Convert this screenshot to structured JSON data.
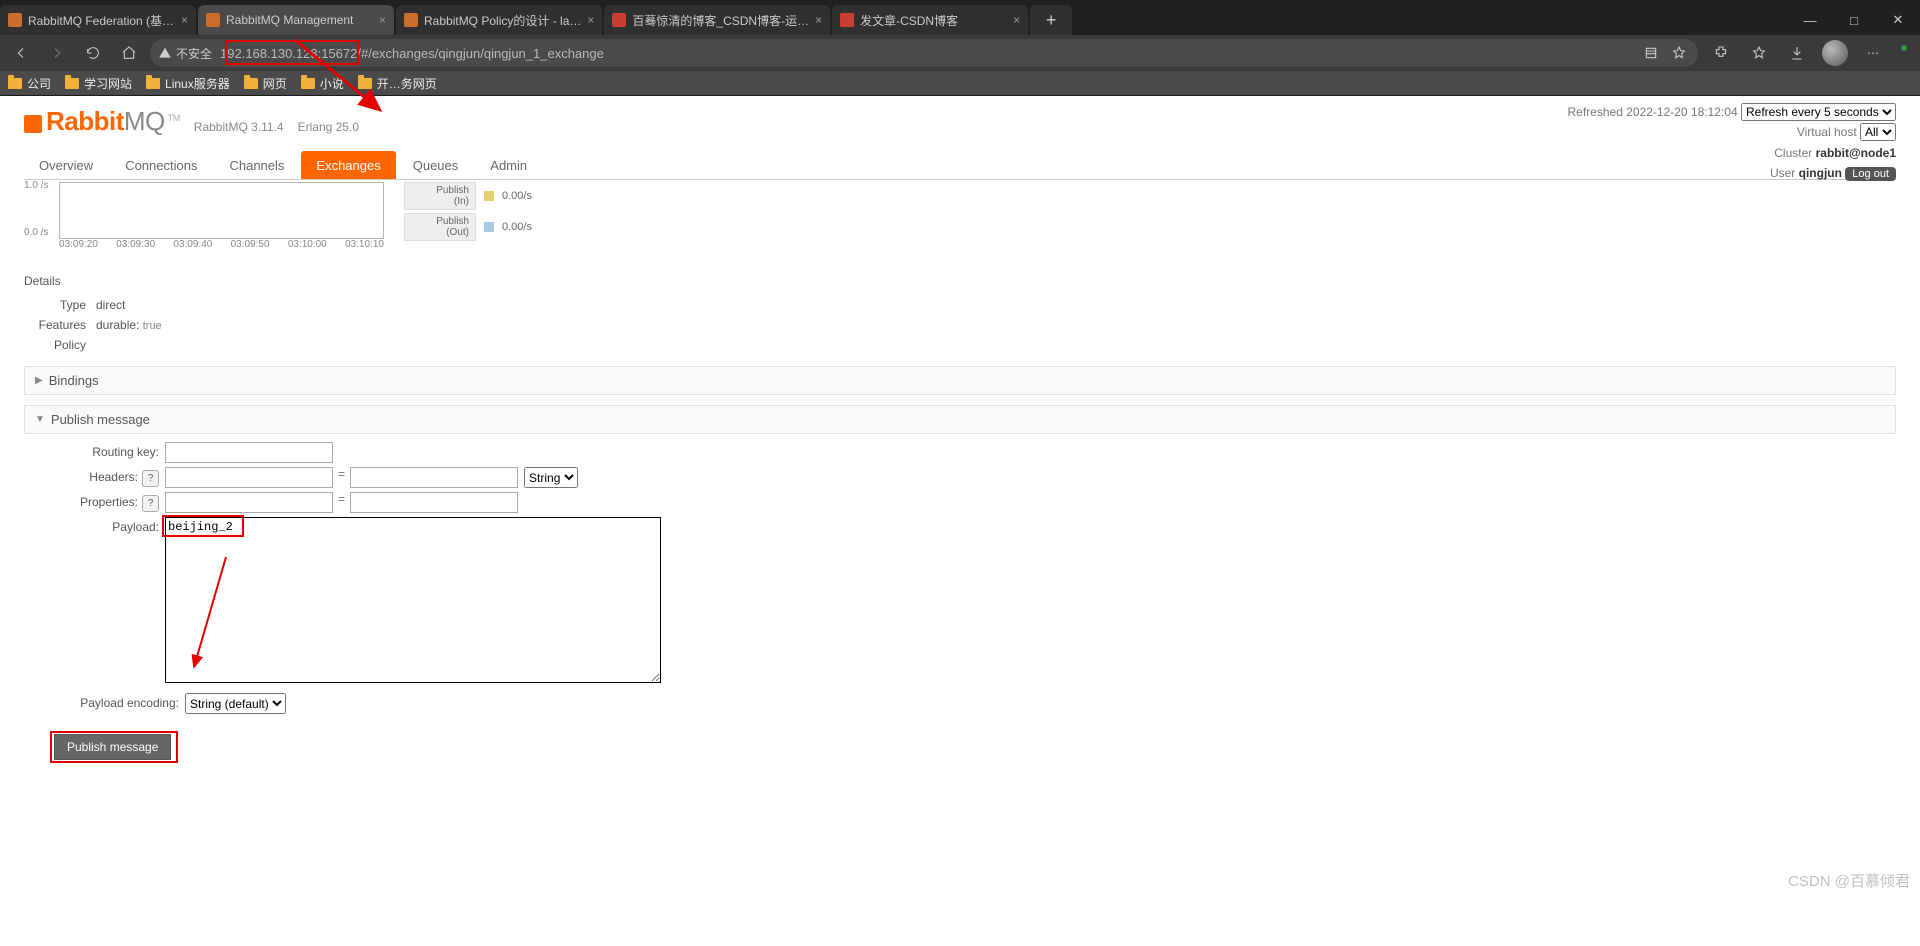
{
  "tabs": [
    {
      "label": "RabbitMQ Federation (基…"
    },
    {
      "label": "RabbitMQ Management",
      "selected": true
    },
    {
      "label": "RabbitMQ Policy的设计 - la…"
    },
    {
      "label": "百蓦惊清的博客_CSDN博客-运…"
    },
    {
      "label": "发文章-CSDN博客"
    }
  ],
  "tab_close": "×",
  "tab_new": "+",
  "win": {
    "min": "—",
    "max": "□",
    "close": "✕"
  },
  "address": {
    "insecure_label": "不安全",
    "url": "192.168.130.128:15672/#/exchanges/qingjun/qingjun_1_exchange"
  },
  "bookmarks": [
    "公司",
    "学习网站",
    "Linux服务器",
    "网页",
    "小说",
    "开…务网页"
  ],
  "logo": {
    "a": "Rabbit",
    "b": "MQ",
    "tm": "TM"
  },
  "versions": {
    "rmq": "RabbitMQ 3.11.4",
    "erlang": "Erlang 25.0"
  },
  "topmeta": {
    "refreshed": "Refreshed 2022-12-20 18:12:04",
    "refresh_options": [
      "Refresh every 5 seconds"
    ],
    "vhost_label": "Virtual host",
    "vhost_options": [
      "All"
    ],
    "cluster_label": "Cluster",
    "cluster_value": "rabbit@node1",
    "user_label": "User",
    "user_value": "qingjun",
    "logout": "Log out"
  },
  "main_tabs": [
    "Overview",
    "Connections",
    "Channels",
    "Exchanges",
    "Queues",
    "Admin"
  ],
  "active_tab": "Exchanges",
  "graph": {
    "ytop": "1.0 /s",
    "ybot": "0.0 /s",
    "xticks": [
      "03:09:20",
      "03:09:30",
      "03:09:40",
      "03:09:50",
      "03:10:00",
      "03:10:10"
    ]
  },
  "rates": [
    {
      "name": "Publish\n(In)",
      "color": "#e7cf6f",
      "value": "0.00/s"
    },
    {
      "name": "Publish\n(Out)",
      "color": "#a9c8e5",
      "value": "0.00/s"
    }
  ],
  "details": {
    "heading": "Details",
    "rows": [
      {
        "lab": "Type",
        "val": "direct"
      },
      {
        "lab": "Features",
        "val": "durable:",
        "extra": "true"
      },
      {
        "lab": "Policy",
        "val": ""
      }
    ]
  },
  "sections": {
    "bindings": {
      "tri": "▶",
      "label": "Bindings"
    },
    "publish": {
      "tri": "▼",
      "label": "Publish message"
    }
  },
  "form": {
    "routing_key_label": "Routing key:",
    "headers_label": "Headers:",
    "properties_label": "Properties:",
    "payload_label": "Payload:",
    "help": "?",
    "eq": "=",
    "header_type_options": [
      "String"
    ],
    "payload_value": "beijing_2",
    "encoding_label": "Payload encoding:",
    "encoding_options": [
      "String (default)"
    ],
    "publish_btn": "Publish message"
  },
  "watermark": "CSDN @百慕倾君"
}
